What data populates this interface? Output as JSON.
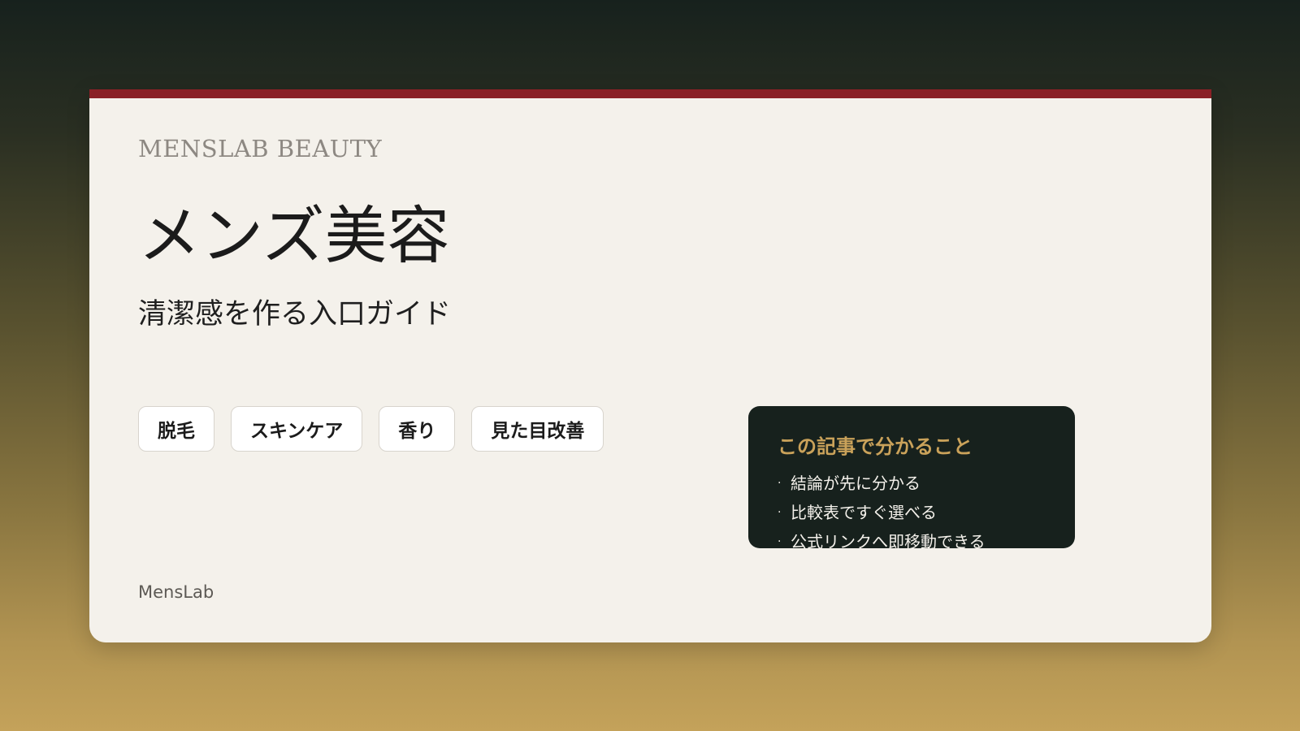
{
  "colors": {
    "background_top": "#17211d",
    "background_bottom": "#c4a25a",
    "card": "#f4f1eb",
    "accent_bar": "#8a2026",
    "info_box": "#17211d",
    "info_title": "#caa25a"
  },
  "brand": "MENSLAB BEAUTY",
  "title": "メンズ美容",
  "subtitle": "清潔感を作る入口ガイド",
  "tags": [
    "脱毛",
    "スキンケア",
    "香り",
    "見た目改善"
  ],
  "info_box": {
    "title": "この記事で分かること",
    "items": [
      "結論が先に分かる",
      "比較表ですぐ選べる",
      "公式リンクへ即移動できる"
    ]
  },
  "footer": "MensLab"
}
